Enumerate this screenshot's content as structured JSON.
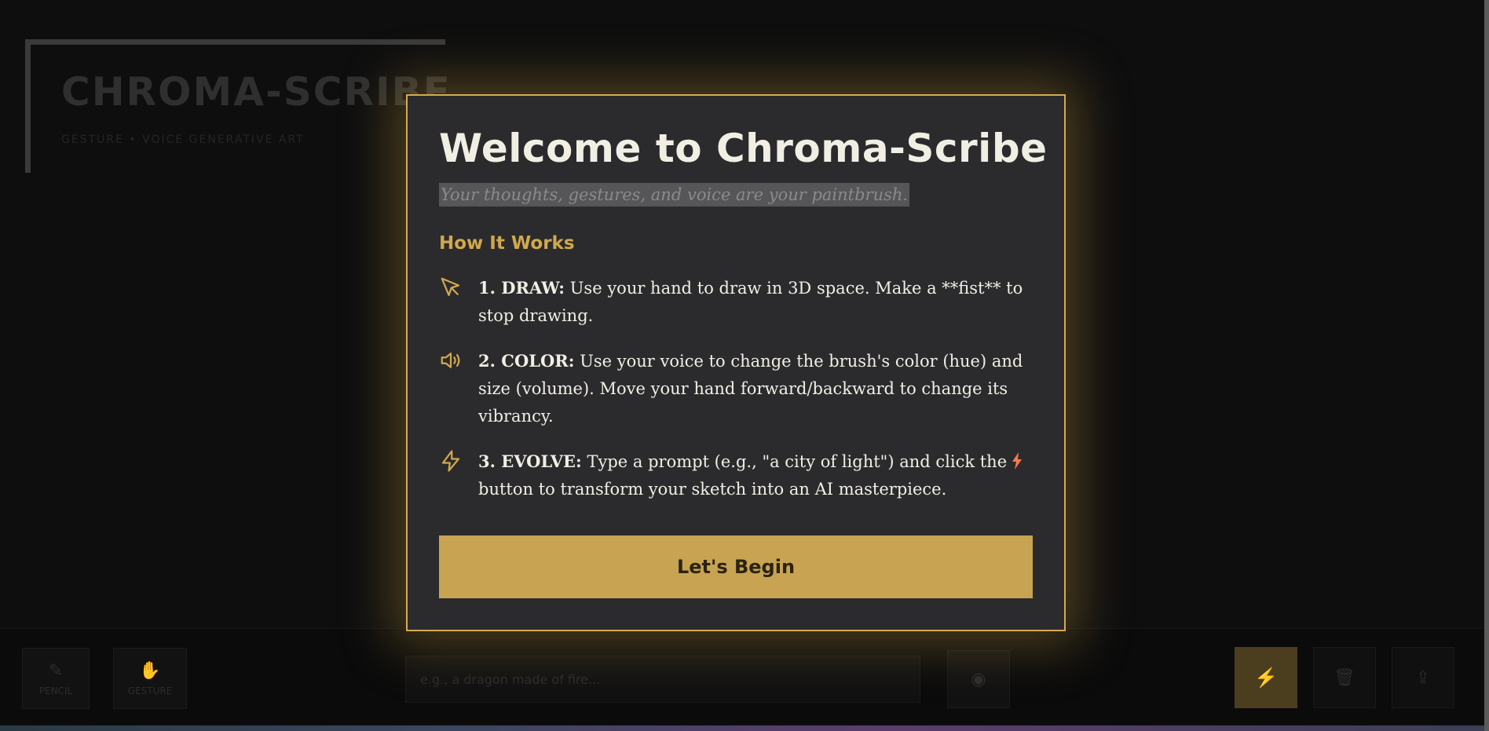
{
  "app": {
    "brand_title": "CHROMA-SCRIBE",
    "brand_subtitle": "GESTURE • VOICE GENERATIVE ART",
    "toolbar": {
      "pencil_label": "PENCIL",
      "gesture_label": "GESTURE",
      "prompt_placeholder": "e.g., a dragon made of fire..."
    }
  },
  "modal": {
    "title": "Welcome to Chroma-Scribe",
    "subtitle": "Your thoughts, gestures, and voice are your paintbrush.",
    "section_heading": "How It Works",
    "steps": [
      {
        "icon": "cursor-arrow-icon",
        "label": "1. DRAW:",
        "text": " Use your hand to draw in 3D space. Make a **fist** to stop drawing."
      },
      {
        "icon": "speaker-icon",
        "label": "2. COLOR:",
        "text": " Use your voice to change the brush's color (hue) and size (volume). Move your hand forward/backward to change its vibrancy."
      },
      {
        "icon": "lightning-icon",
        "label": "3. EVOLVE:",
        "text_before": " Type a prompt (e.g., \"a city of light\") and click the",
        "text_after": " button to transform your sketch into an AI masterpiece."
      }
    ],
    "begin_button": "Let's Begin"
  },
  "colors": {
    "accent_gold": "#c8a352",
    "modal_border": "#d4aa52",
    "modal_bg": "#2b2b2e",
    "inline_bolt": "#ff7a45"
  }
}
